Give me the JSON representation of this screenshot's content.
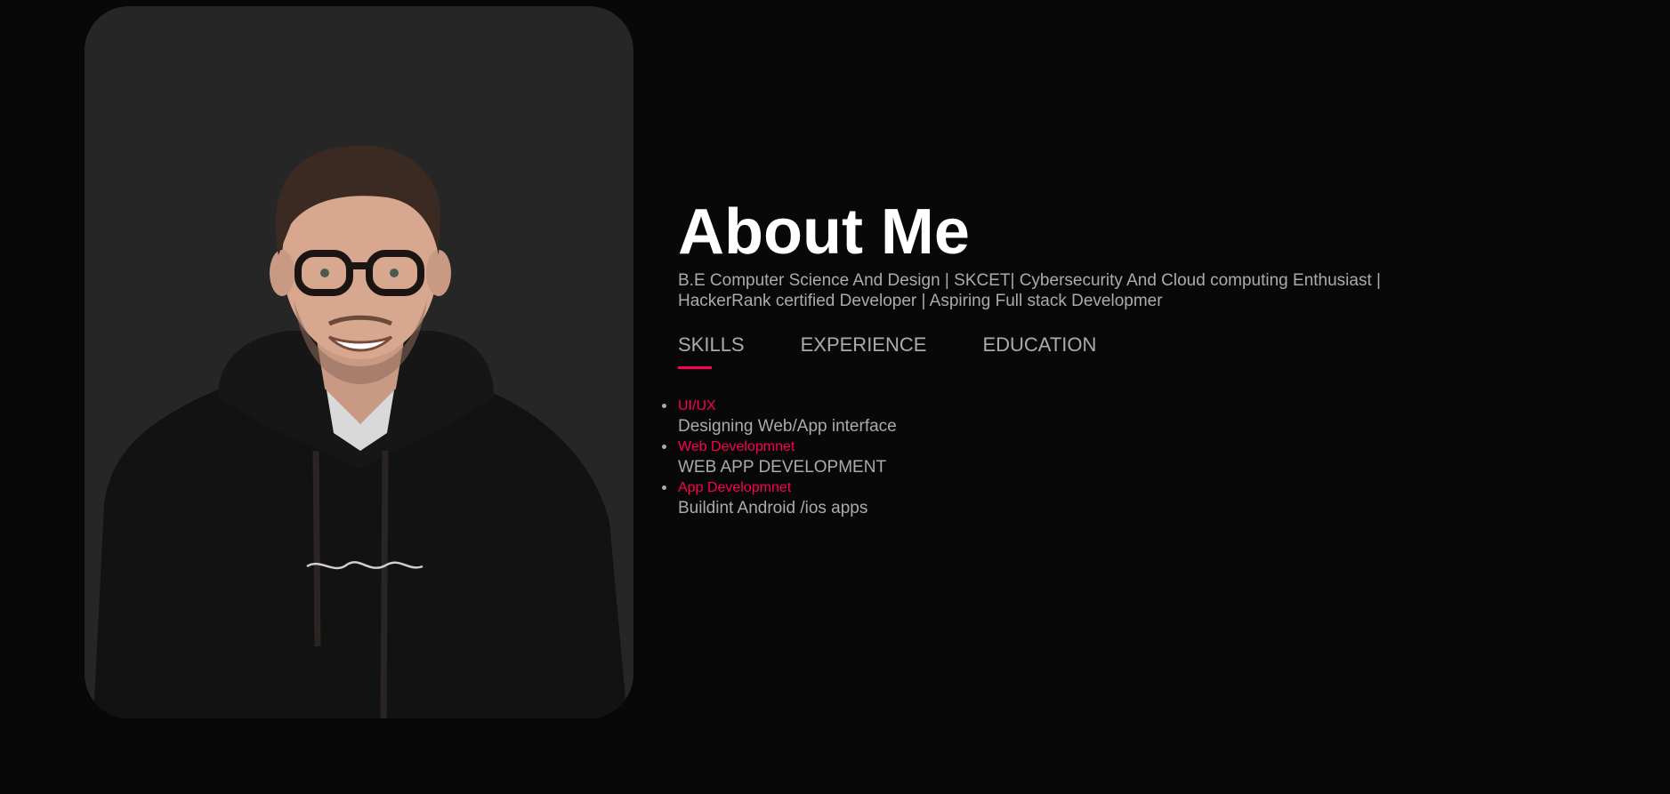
{
  "about": {
    "title": "About Me",
    "description": "B.E Computer Science And Design | SKCET| Cybersecurity And Cloud computing Enthusiast | HackerRank certified Developer | Aspiring Full stack Developmer"
  },
  "tabs": [
    {
      "label": "SKILLS",
      "active": true
    },
    {
      "label": "EXPERIENCE",
      "active": false
    },
    {
      "label": "EDUCATION",
      "active": false
    }
  ],
  "skills": [
    {
      "name": "UI/UX",
      "detail": "Designing Web/App interface"
    },
    {
      "name": "Web Developmnet",
      "detail": "WEB APP DEVELOPMENT"
    },
    {
      "name": "App Developmnet",
      "detail": "Buildint Android /ios apps"
    }
  ],
  "colors": {
    "background": "#080808",
    "card": "#262626",
    "accent": "#ff004f",
    "text": "#ababab",
    "heading": "#ffffff"
  },
  "icons": {
    "photo": "user-portrait"
  }
}
